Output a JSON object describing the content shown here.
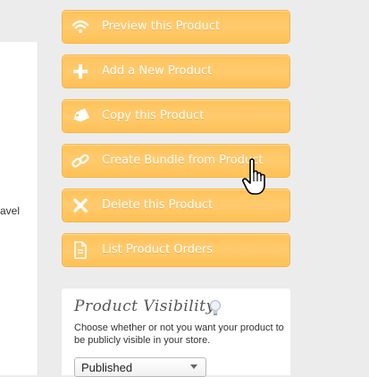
{
  "left": {
    "snippet": "avel"
  },
  "actions": [
    {
      "label": "Preview this Product",
      "icon": "wifi-icon"
    },
    {
      "label": "Add a New Product",
      "icon": "plus-icon"
    },
    {
      "label": "Copy this Product",
      "icon": "tag-icon"
    },
    {
      "label": "Create Bundle from Product",
      "icon": "link-icon"
    },
    {
      "label": "Delete this Product",
      "icon": "close-icon"
    },
    {
      "label": "List Product Orders",
      "icon": "document-icon"
    }
  ],
  "visibility": {
    "title": "Product Visibility",
    "description": "Choose whether or not you want your product to be publicly visible in your store.",
    "selected": "Published"
  },
  "colors": {
    "button": "#ffc35a",
    "button_text": "#ffffff"
  }
}
